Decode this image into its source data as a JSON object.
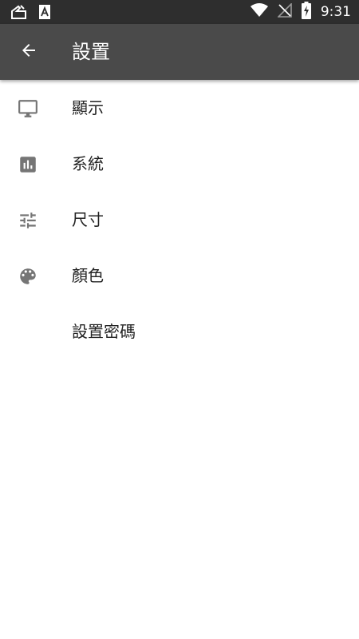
{
  "status_bar": {
    "time": "9:31",
    "left_icons": [
      "broom-notification-icon",
      "app-notification-icon"
    ],
    "right_icons": [
      "wifi-icon",
      "no-signal-icon",
      "battery-charging-icon"
    ]
  },
  "app_bar": {
    "title": "設置",
    "back_icon": "arrow-back-icon",
    "background": "#4a4a4a"
  },
  "settings": {
    "items": [
      {
        "label": "顯示",
        "icon": "monitor-icon"
      },
      {
        "label": "系統",
        "icon": "bar-chart-icon"
      },
      {
        "label": "尺寸",
        "icon": "tune-sliders-icon"
      },
      {
        "label": "顏色",
        "icon": "palette-icon"
      },
      {
        "label": "設置密碼",
        "icon": ""
      }
    ]
  },
  "colors": {
    "status_bar": "#2e2e2e",
    "icon_gray": "#757575",
    "text": "#222222"
  }
}
